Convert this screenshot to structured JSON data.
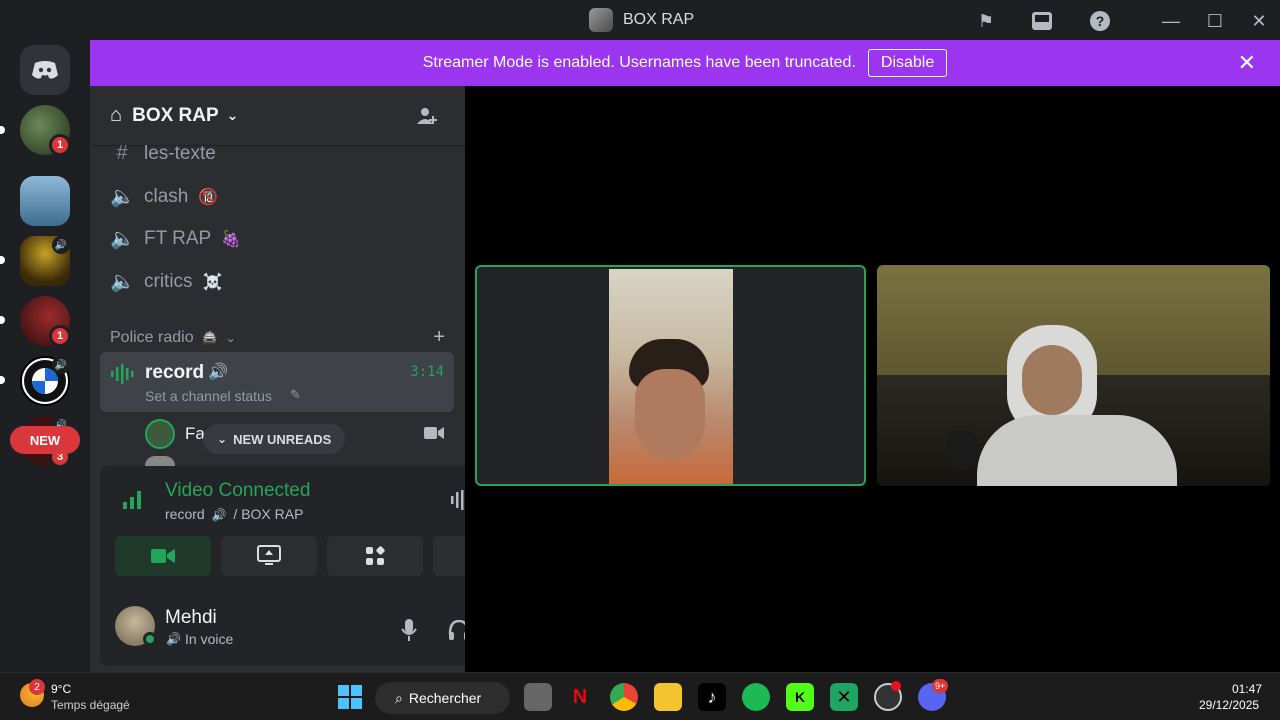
{
  "window": {
    "title": "BOX RAP"
  },
  "banner": {
    "text": "Streamer Mode is enabled. Usernames have been truncated.",
    "button": "Disable"
  },
  "rail": {
    "new_pill": "NEW",
    "badges": [
      "1",
      "1",
      "3"
    ]
  },
  "guild": {
    "name": "BOX RAP"
  },
  "channels": [
    {
      "name": "les-texte",
      "emoji": ""
    },
    {
      "name": "clash",
      "emoji": "🔞"
    },
    {
      "name": "FT RAP",
      "emoji": "🍇"
    },
    {
      "name": "critics",
      "emoji": "☠️"
    }
  ],
  "category": {
    "name": "Police radio",
    "emoji": "🚔"
  },
  "voice_channel": {
    "name": "record",
    "status": "Set a channel status",
    "timer": "3:14"
  },
  "participant": {
    "name": "Fa"
  },
  "unreads_pill": "NEW UNREADS",
  "voice_panel": {
    "state": "Video Connected",
    "channel": "record",
    "server": "/ BOX RAP"
  },
  "user": {
    "name": "Mehdi",
    "status": "In voice"
  },
  "taskbar": {
    "weather_temp": "9°C",
    "weather_desc": "Temps dégagé",
    "weather_badge": "2",
    "search": "Rechercher",
    "discord_badge": "9+",
    "time": "01:47",
    "date": "29/12/2025"
  },
  "colors": {
    "accent_green": "#23a55a",
    "banner": "#9b35f0",
    "alert_red": "#da373c"
  }
}
